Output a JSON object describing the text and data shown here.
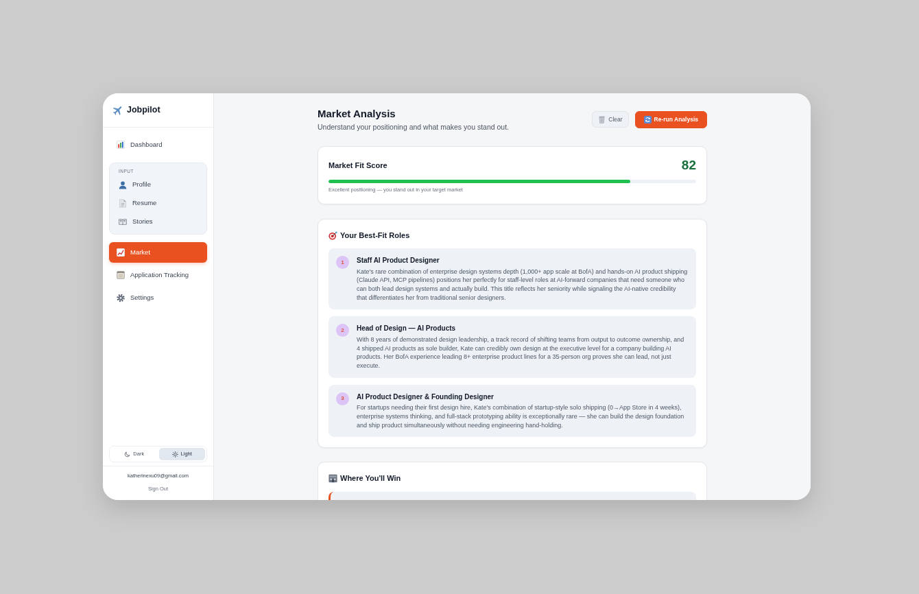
{
  "sidebar": {
    "brand": "Jobpilot",
    "nav": [
      {
        "kind": "link",
        "label": "Dashboard",
        "selected": false
      },
      {
        "kind": "group",
        "label": "INPUT",
        "children": [
          {
            "label": "Profile",
            "selected": false
          },
          {
            "label": "Resume",
            "selected": false
          },
          {
            "label": "Stories",
            "selected": false
          }
        ]
      },
      {
        "kind": "link",
        "label": "Market",
        "selected": true
      },
      {
        "kind": "link",
        "label": "Application Tracking",
        "selected": false
      },
      {
        "kind": "link",
        "label": "Settings",
        "selected": false
      }
    ],
    "theme_toggle": [
      {
        "label": "Dark",
        "selected": false
      },
      {
        "label": "Light",
        "selected": true
      }
    ],
    "account": {
      "email": "katherinexu09@gmail.com",
      "sign_out": "Sign Out"
    }
  },
  "header": {
    "title": "Market Analysis",
    "subtitle": "Understand your positioning and what makes you stand out.",
    "buttons": [
      {
        "kind": "secondary",
        "label": "Clear"
      },
      {
        "kind": "primary",
        "label": "Re-run Analysis"
      }
    ]
  },
  "score_card": {
    "title": "Market Fit Score",
    "score": "82",
    "level": 0.82,
    "caption": "Excellent positioning — you stand out in your target market"
  },
  "best_fit_roles": {
    "title": "Your Best-Fit Roles",
    "roles": [
      {
        "number": "1",
        "title": "Staff AI Product Designer",
        "description": "Kate's rare combination of enterprise design systems depth (1,000+ app scale at BofA) and hands-on AI product shipping (Claude API, MCP pipelines) positions her perfectly for staff-level roles at AI-forward companies that need someone who can both lead design systems and actually build. This title reflects her seniority while signaling the AI-native credibility that differentiates her from traditional senior designers."
      },
      {
        "number": "2",
        "title": "Head of Design — AI Products",
        "description": "With 8 years of demonstrated design leadership, a track record of shifting teams from output to outcome ownership, and 4 shipped AI products as sole builder, Kate can credibly own design at the executive level for a company building AI products. Her BofA experience leading 8+ enterprise product lines for a 35-person org proves she can lead, not just execute."
      },
      {
        "number": "3",
        "title": "AI Product Designer & Founding Designer",
        "description": "For startups needing their first design hire, Kate's combination of startup-style solo shipping (0→App Store in 4 weeks), enterprise systems thinking, and full-stack prototyping ability is exceptionally rare — she can build the design foundation and ship product simultaneously without needing engineering hand-holding."
      }
    ]
  },
  "where_you_win": {
    "title": "Where You'll Win"
  }
}
